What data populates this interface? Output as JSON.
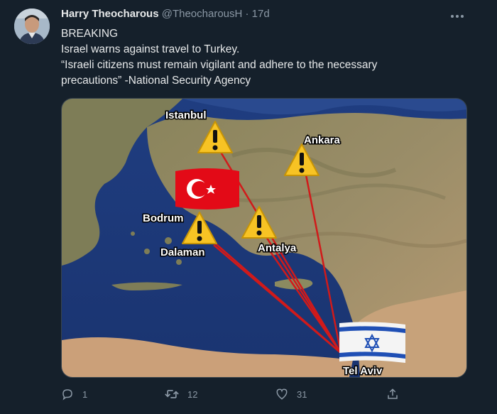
{
  "tweet": {
    "author_name": "Harry Theocharous",
    "author_handle": "@TheocharousH",
    "time": "· 17d",
    "text_lines": [
      "BREAKING",
      "Israel warns against travel to Turkey.",
      "“Israeli citizens must remain vigilant and adhere to the necessary",
      "precautions” -National Security Agency"
    ]
  },
  "map": {
    "labels": {
      "istanbul": "Istanbul",
      "ankara": "Ankara",
      "bodrum": "Bodrum",
      "dalaman": "Dalaman",
      "antalya": "Antalya",
      "tel_aviv": "Tel Aviv"
    },
    "warning_icon": "warning-triangle-icon",
    "flags": [
      "turkey-flag",
      "israel-flag"
    ]
  },
  "actions": {
    "reply_count": "1",
    "retweet_count": "12",
    "like_count": "31"
  },
  "colors": {
    "background": "#15202b",
    "muted": "#8b98a5",
    "route_line": "#d11a1a",
    "warning_fill": "#f7c324"
  }
}
